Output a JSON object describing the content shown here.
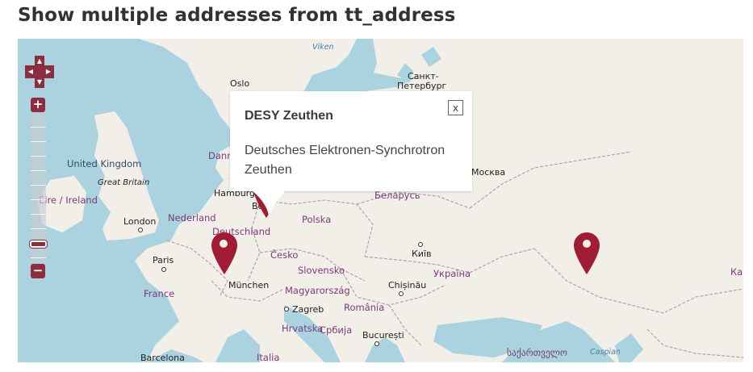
{
  "page": {
    "title": "Show multiple addresses from tt_address"
  },
  "map": {
    "colors": {
      "water": "#aad3df",
      "land": "#f2efe9",
      "border": "#b49fb8",
      "marker": "#a01c34",
      "control": "#8d2d3f"
    },
    "controls": {
      "pan_up_icon": "arrow-up-icon",
      "pan_down_icon": "arrow-down-icon",
      "pan_left_icon": "arrow-left-icon",
      "pan_right_icon": "arrow-right-icon",
      "zoom_in_label": "+",
      "zoom_out_label": "−"
    },
    "labels": {
      "viken": "Viken",
      "oslo": "Oslo",
      "spb_1": "Санкт-",
      "spb_2": "Петербург",
      "danmark": "Danm",
      "united_kingdom": "United Kingdom",
      "great_britain": "Great Britain",
      "eire": "Éire / Ireland",
      "hamburg": "Hamburg",
      "berlin": "Berl",
      "london": "London",
      "nederland": "Nederland",
      "deutschland": "Deutschland",
      "polska": "Polska",
      "belarus": "Беларусь",
      "moskva": "Москва",
      "paris": "Paris",
      "cesko": "Česko",
      "kyiv": "Київ",
      "slovensko": "Slovensko",
      "ukraina": "Україна",
      "france": "France",
      "munchen": "München",
      "magyarorszag": "Magyarország",
      "chisinau": "Chișinău",
      "zagreb": "Zagreb",
      "romania": "România",
      "hrvatska": "Hrvatska",
      "srbija": "Србија",
      "bucuresti": "București",
      "barcelona": "Barcelona",
      "italia": "Italia",
      "sakartvelo": "საქართველო",
      "caspian": "Caspian",
      "kaz": "Каз"
    },
    "markers": [
      {
        "name": "marker-zeuthen",
        "icon": "map-pin-icon"
      },
      {
        "name": "marker-karlsruhe",
        "icon": "map-pin-icon"
      },
      {
        "name": "marker-russia",
        "icon": "map-pin-icon"
      }
    ],
    "popup": {
      "title": "DESY Zeuthen",
      "body": "Deutsches Elektronen-Synchrotron Zeuthen",
      "close_label": "x"
    }
  }
}
